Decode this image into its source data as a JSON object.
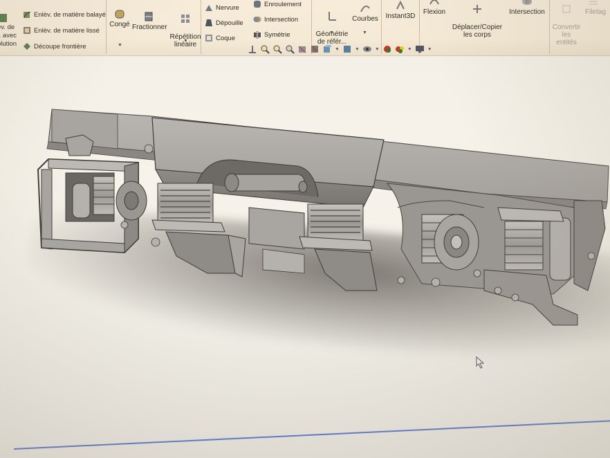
{
  "ribbon": {
    "left_cut_labels": [
      "év. de",
      "t. avec",
      "olution"
    ],
    "small_items": [
      {
        "label": "Enlèv. de matière balayé",
        "icon": "sweep-cut-icon"
      },
      {
        "label": "Enlèv. de matière lissé",
        "icon": "lofted-cut-icon"
      },
      {
        "label": "Découpe frontière",
        "icon": "boundary-cut-icon"
      }
    ],
    "conge": "Congé",
    "fractionner": "Fractionner",
    "repetition": "Répétition\nlinéaire",
    "features_col": [
      {
        "label": "Nervure",
        "icon": "rib-icon"
      },
      {
        "label": "Dépouille",
        "icon": "draft-icon"
      },
      {
        "label": "Coque",
        "icon": "shell-icon"
      }
    ],
    "features_col2": [
      {
        "label": "Enroulement",
        "icon": "wrap-icon"
      },
      {
        "label": "Intersection",
        "icon": "intersect-icon"
      },
      {
        "label": "Symétrie",
        "icon": "mirror-icon"
      }
    ],
    "geometrie": "Géométrie\nde référ...",
    "courbes": "Courbes",
    "instant3d": "Instant3D",
    "flexion": "Flexion",
    "deplacer": "Déplacer/Copier\nles corps",
    "intersection2": "Intersection",
    "convertir": "Convertir\nles\nentités",
    "filetage": "Filetag"
  },
  "view_toolbar": {
    "icons": [
      "orient-icon",
      "zoom-fit-icon",
      "zoom-area-icon",
      "previous-view-icon",
      "section-view-icon",
      "dynamic-annotation-icon",
      "view-orientation-icon",
      "display-style-icon",
      "hide-show-icon",
      "edit-appearance-icon",
      "apply-scene-icon",
      "view-settings-icon"
    ]
  },
  "colors": {
    "ribbon_bg": "#f4ead6",
    "model_grey": "#9e9a96",
    "accent_blue": "#5a78c8"
  }
}
